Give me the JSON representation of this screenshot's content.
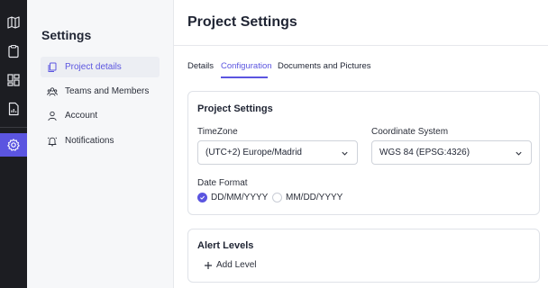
{
  "rail": {
    "items": [
      {
        "icon": "map-icon"
      },
      {
        "icon": "clipboard-icon"
      },
      {
        "icon": "dashboard-icon"
      },
      {
        "icon": "document-chart-icon"
      },
      {
        "icon": "gear-icon",
        "active": true
      }
    ]
  },
  "sidebar": {
    "title": "Settings",
    "items": [
      {
        "label": "Project details",
        "icon": "copy-icon",
        "active": true
      },
      {
        "label": "Teams and Members",
        "icon": "team-icon"
      },
      {
        "label": "Account",
        "icon": "user-icon"
      },
      {
        "label": "Notifications",
        "icon": "bell-icon"
      }
    ]
  },
  "page": {
    "title": "Project Settings",
    "tabs": [
      {
        "label": "Details"
      },
      {
        "label": "Configuration",
        "active": true
      },
      {
        "label": "Documents and Pictures"
      }
    ]
  },
  "project_settings": {
    "title": "Project Settings",
    "timezone_label": "TimeZone",
    "timezone_value": "(UTC+2) Europe/Madrid",
    "coordinate_label": "Coordinate System",
    "coordinate_value": "WGS 84 (EPSG:4326)",
    "date_format_label": "Date Format",
    "date_options": [
      {
        "label": "DD/MM/YYYY",
        "selected": true
      },
      {
        "label": "MM/DD/YYYY",
        "selected": false
      }
    ]
  },
  "alert_levels": {
    "title": "Alert Levels",
    "add_label": "Add Level"
  },
  "colors": {
    "accent": "#5b55e0",
    "rail_bg": "#1c1d22",
    "sidebar_bg": "#f6f7f9"
  }
}
